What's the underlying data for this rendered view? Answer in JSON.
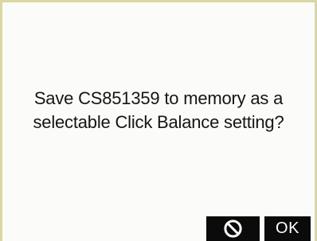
{
  "dialog": {
    "message_line_1": "Save CS851359 to memory as a",
    "message_line_2": "selectable Click Balance setting?"
  },
  "buttons": {
    "cancel_icon": "cancel-icon",
    "ok_label": "OK"
  },
  "colors": {
    "border": "#d8d6a4",
    "background": "#fbfbfa",
    "button_background": "#0b0b0b",
    "button_text": "#ffffff",
    "text": "#151515"
  }
}
